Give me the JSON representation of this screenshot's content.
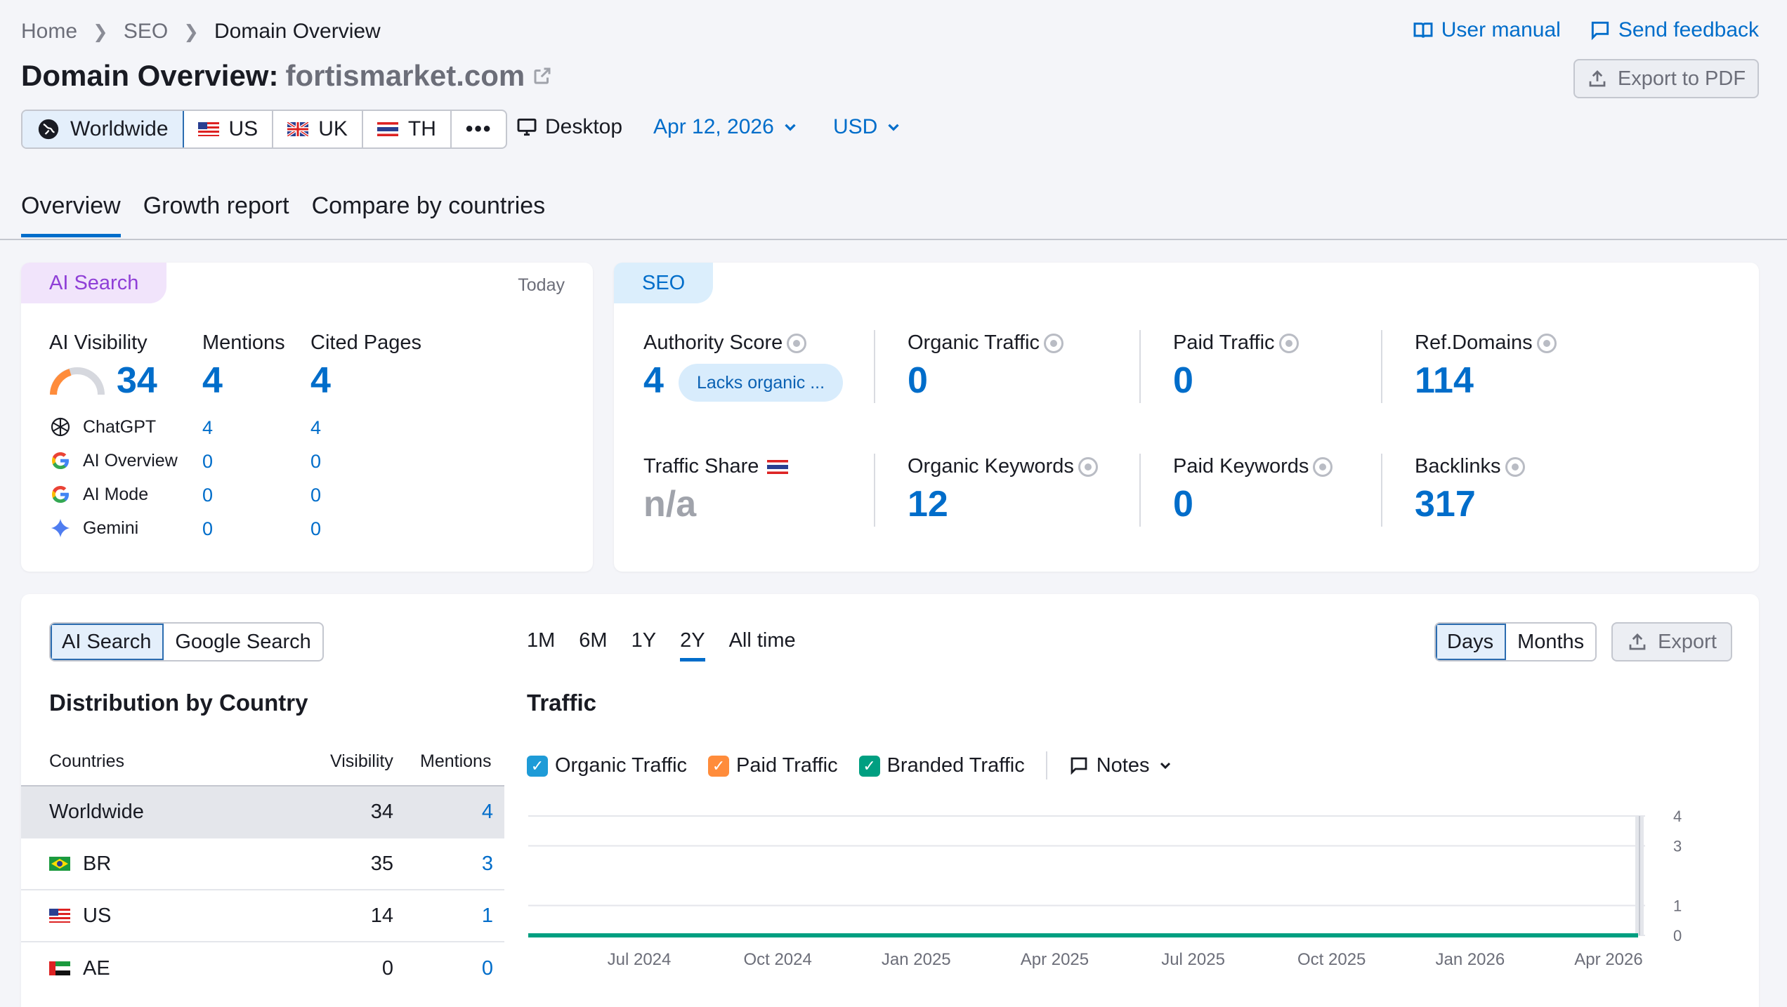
{
  "breadcrumb": [
    "Home",
    "SEO",
    "Domain Overview"
  ],
  "header": {
    "title": "Domain Overview:",
    "domain": "fortismarket.com",
    "user_manual": "User manual",
    "send_feedback": "Send feedback",
    "export_pdf": "Export to PDF"
  },
  "db_tabs": [
    "Worldwide",
    "US",
    "UK",
    "TH"
  ],
  "options": {
    "device": "Desktop",
    "date": "Apr 12, 2026",
    "currency": "USD"
  },
  "nav_tabs": [
    "Overview",
    "Growth report",
    "Compare by countries"
  ],
  "ai_card": {
    "pill": "AI Search",
    "period": "Today",
    "col_visibility": "AI Visibility",
    "col_mentions": "Mentions",
    "col_cited": "Cited Pages",
    "visibility": "34",
    "mentions": "4",
    "cited": "4",
    "llms": [
      {
        "name": "ChatGPT",
        "mentions": "4",
        "cited": "4"
      },
      {
        "name": "AI Overview",
        "mentions": "0",
        "cited": "0"
      },
      {
        "name": "AI Mode",
        "mentions": "0",
        "cited": "0"
      },
      {
        "name": "Gemini",
        "mentions": "0",
        "cited": "0"
      }
    ]
  },
  "seo_card": {
    "pill": "SEO",
    "authority_label": "Authority Score",
    "authority_value": "4",
    "authority_badge": "Lacks organic ...",
    "organic_traffic_label": "Organic Traffic",
    "organic_traffic_value": "0",
    "paid_traffic_label": "Paid Traffic",
    "paid_traffic_value": "0",
    "ref_domains_label": "Ref.Domains",
    "ref_domains_value": "114",
    "traffic_share_label": "Traffic Share",
    "traffic_share_value": "n/a",
    "organic_keywords_label": "Organic Keywords",
    "organic_keywords_value": "12",
    "paid_keywords_label": "Paid Keywords",
    "paid_keywords_value": "0",
    "backlinks_label": "Backlinks",
    "backlinks_value": "317"
  },
  "bottom": {
    "search_toggle": [
      "AI Search",
      "Google Search"
    ],
    "ranges": [
      "1M",
      "6M",
      "1Y",
      "2Y",
      "All time"
    ],
    "granularity": [
      "Days",
      "Months"
    ],
    "export": "Export",
    "dist_title": "Distribution by Country",
    "col_countries": "Countries",
    "col_visibility": "Visibility",
    "col_mentions": "Mentions",
    "rows": [
      {
        "country": "Worldwide",
        "visibility": "34",
        "mentions": "4"
      },
      {
        "country": "BR",
        "visibility": "35",
        "mentions": "3"
      },
      {
        "country": "US",
        "visibility": "14",
        "mentions": "1"
      },
      {
        "country": "AE",
        "visibility": "0",
        "mentions": "0"
      }
    ],
    "traffic_title": "Traffic",
    "legend": [
      "Organic Traffic",
      "Paid Traffic",
      "Branded Traffic"
    ],
    "notes": "Notes"
  },
  "chart_data": {
    "type": "line",
    "x_ticks": [
      "Jul 2024",
      "Oct 2024",
      "Jan 2025",
      "Apr 2025",
      "Jul 2025",
      "Oct 2025",
      "Jan 2026",
      "Apr 2026"
    ],
    "y_ticks": [
      0,
      1,
      3,
      4
    ],
    "ylim": [
      0,
      4
    ],
    "series": [
      {
        "name": "Organic Traffic",
        "values": [
          0,
          0,
          0,
          0,
          0,
          0,
          0,
          0
        ]
      }
    ],
    "colors": {
      "organic": "#1e9bd7",
      "paid": "#ff8c3b",
      "branded": "#009f81",
      "line": "#009f81"
    }
  }
}
